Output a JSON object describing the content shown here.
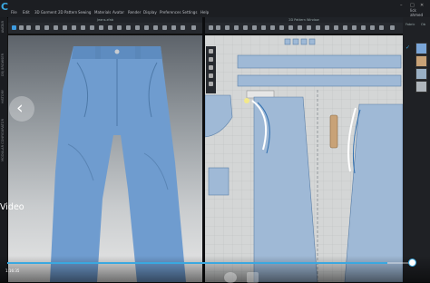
{
  "app": {
    "logo": "C",
    "user_line1": "lick",
    "user_line2": "ahmed"
  },
  "menu": [
    "File",
    "Edit",
    "3D Garment",
    "2D Pattern",
    "Sewing",
    "Materials",
    "Avatar",
    "Render",
    "Display",
    "Preferences",
    "Settings",
    "Help"
  ],
  "window_buttons": {
    "minimize": "–",
    "maximize": "□",
    "close": "✕"
  },
  "left_toolbar_labels": [
    "AVATAR",
    "OBJ BROWSER",
    "HISTORY",
    "MODULAR CONFIGURATOR"
  ],
  "panels": {
    "view3d_title": "Jeans.zfab",
    "view2d_title": "2D Pattern Window"
  },
  "right_panel": {
    "tabs": [
      "Fabric",
      "Ob"
    ],
    "check": "✓",
    "swatch_colors": [
      "#7aa6d8",
      "#c8a277",
      "#9ab0c4",
      "#b0b6bc"
    ]
  },
  "video": {
    "label": "Video",
    "time": "1:16:35",
    "progress_fraction": 0.94
  },
  "nav": {
    "prev": "‹"
  },
  "colors": {
    "accent": "#3aa8e0",
    "denim": "#6f9ccf",
    "pattern_blue": "#9fb9d6",
    "grid_bg": "#d4d6d6"
  }
}
